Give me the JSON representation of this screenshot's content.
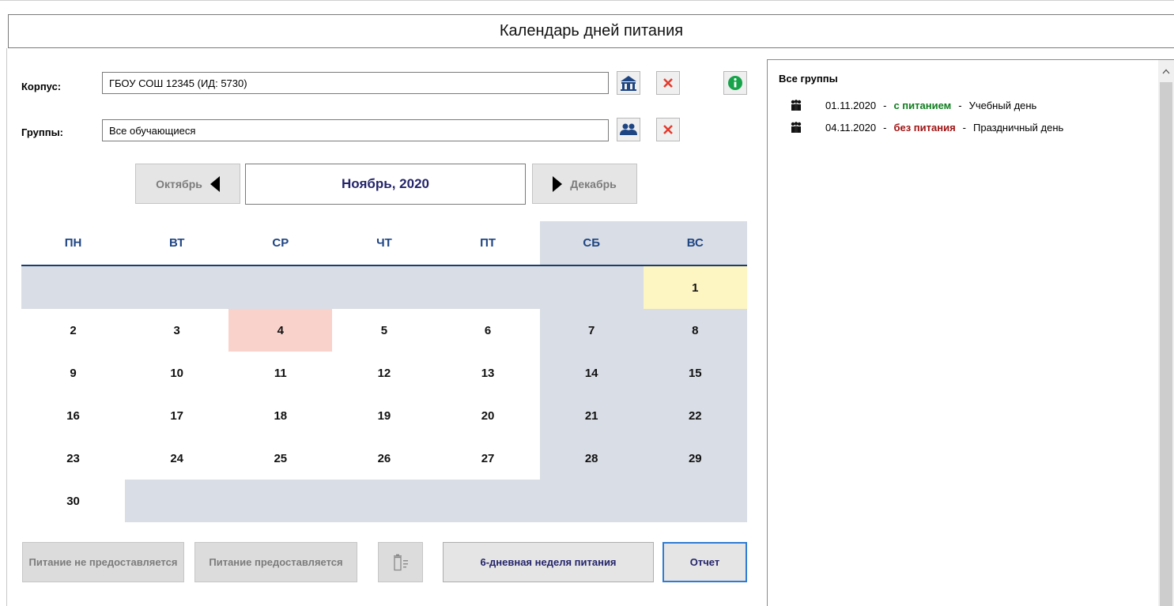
{
  "window": {
    "title": "Календарь дней питания"
  },
  "building": {
    "label": "Корпус:",
    "value": "ГБОУ СОШ 12345 (ИД: 5730)"
  },
  "groups": {
    "label": "Группы:",
    "value": "Все обучающиеся"
  },
  "icons": {
    "building_select": "school-icon",
    "building_clear": "close-icon",
    "info": "info-icon",
    "groups_select": "people-icon",
    "groups_clear": "close-icon",
    "trash": "trash-list-icon",
    "group_entry": "group-people-icon"
  },
  "nav": {
    "prev_label": "Октябрь",
    "current_label": "Ноябрь, 2020",
    "next_label": "Декабрь"
  },
  "calendar": {
    "weekdays": [
      "ПН",
      "ВТ",
      "СР",
      "ЧТ",
      "ПТ",
      "СБ",
      "ВС"
    ],
    "weeks": [
      [
        "",
        "",
        "",
        "",
        "",
        "",
        "1"
      ],
      [
        "2",
        "3",
        "4",
        "5",
        "6",
        "7",
        "8"
      ],
      [
        "9",
        "10",
        "11",
        "12",
        "13",
        "14",
        "15"
      ],
      [
        "16",
        "17",
        "18",
        "19",
        "20",
        "21",
        "22"
      ],
      [
        "23",
        "24",
        "25",
        "26",
        "27",
        "28",
        "29"
      ],
      [
        "30",
        "",
        "",
        "",
        "",
        "",
        ""
      ]
    ],
    "feeding_days": [
      "1"
    ],
    "non_feeding_days": [
      "4"
    ]
  },
  "buttons": {
    "no_meal": "Питание не предоставляется",
    "meal": "Питание предоставляется",
    "six_day": "6-дневная неделя питания",
    "report": "Отчет"
  },
  "panel": {
    "title": "Все группы",
    "entries": [
      {
        "date": "01.11.2020",
        "status": "с питанием",
        "status_type": "feed",
        "day_type": "Учебный день"
      },
      {
        "date": "04.11.2020",
        "status": "без питания",
        "status_type": "nofeed",
        "day_type": "Праздничный день"
      }
    ]
  },
  "colors": {
    "accent_blue": "#1e4583",
    "weekend_bg": "#d9dde5",
    "feeding_day": "#fdf5c2",
    "non_feeding_day": "#f9d2cc",
    "status_green": "#0f7d1e",
    "status_red": "#a01414",
    "clear_red": "#e33b2e",
    "info_green": "#17a34a"
  }
}
